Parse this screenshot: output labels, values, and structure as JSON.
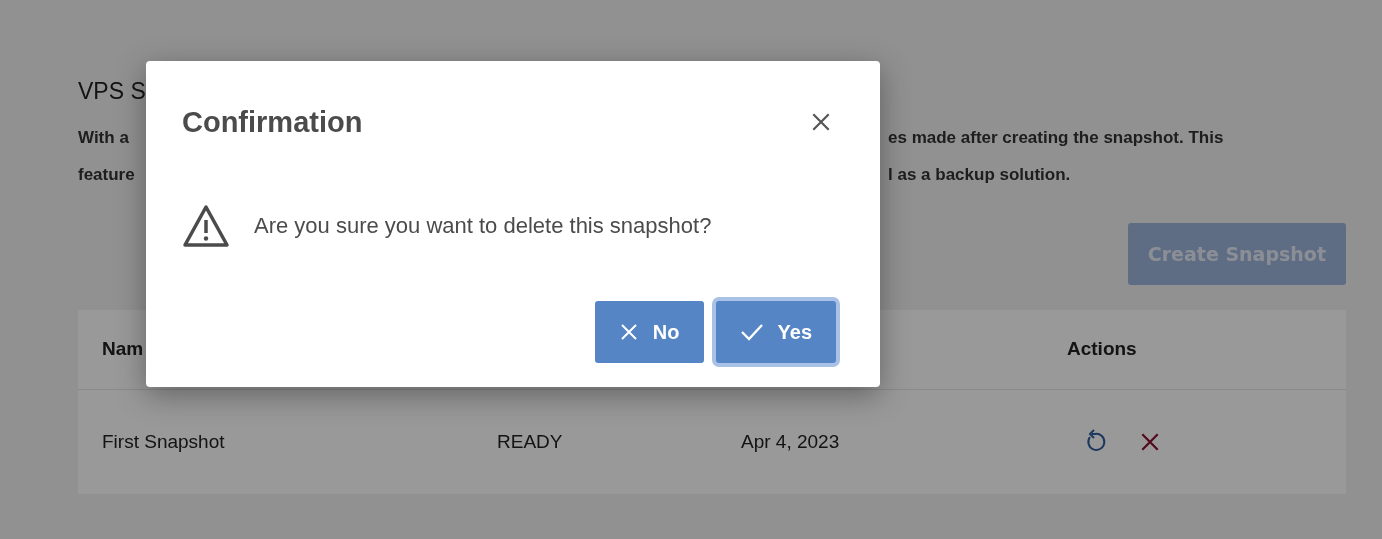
{
  "page": {
    "heading": "VPS S",
    "description_lines": [
      {
        "left": "With a",
        "right": "es made after creating the snapshot. This"
      },
      {
        "left": "feature",
        "right": "l as a backup solution."
      }
    ],
    "create_button": {
      "label": "Create Snapshot",
      "disabled": true
    }
  },
  "table": {
    "columns": [
      {
        "label": "Nam"
      },
      {},
      {},
      {
        "label": "Actions"
      }
    ],
    "rows": [
      {
        "cells": [
          "First Snapshot",
          "READY",
          "Apr 4, 2023"
        ]
      }
    ]
  },
  "dialog": {
    "title": "Confirmation",
    "message": "Are you sure you want to delete this snapshot?",
    "buttons": [
      {
        "kind": "no",
        "label": "No",
        "focused": false
      },
      {
        "kind": "yes",
        "label": "Yes",
        "focused": true
      }
    ]
  }
}
